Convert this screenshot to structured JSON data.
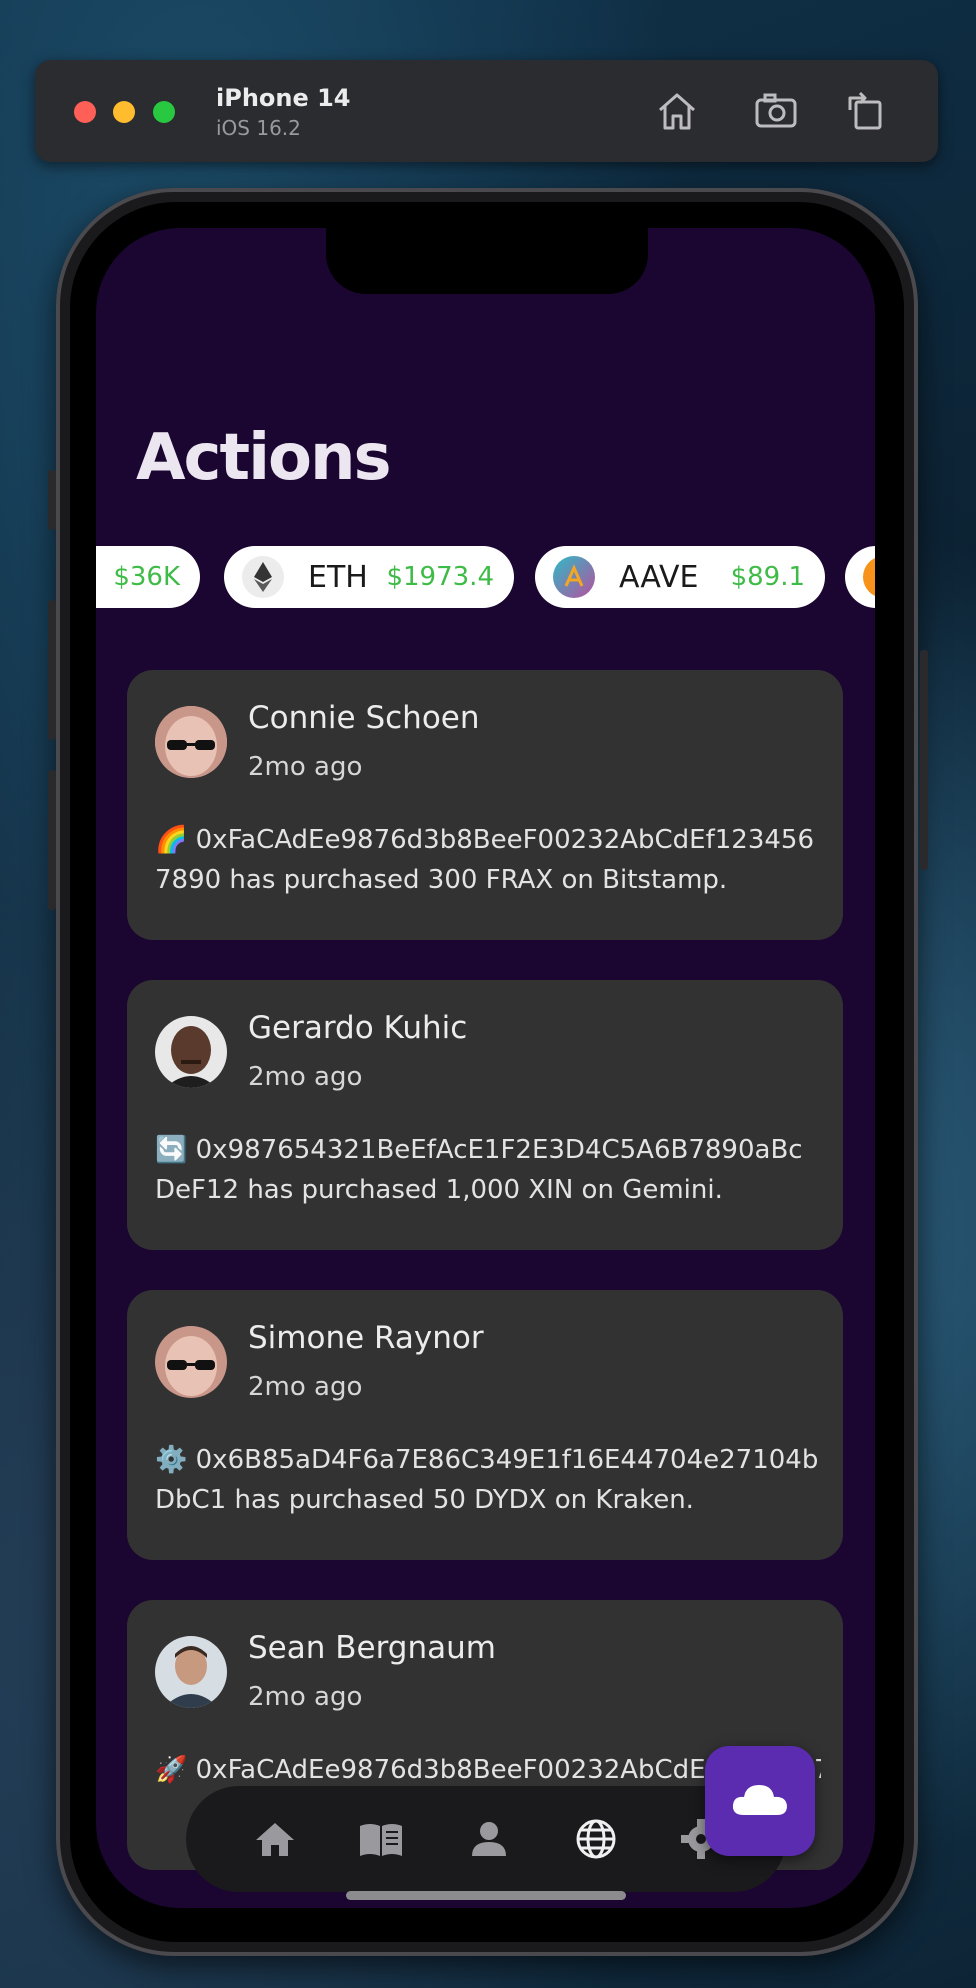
{
  "simulator": {
    "device_name": "iPhone 14",
    "os_version": "iOS 16.2",
    "buttons": [
      "home-icon",
      "screenshot-icon",
      "rotate-icon"
    ]
  },
  "app": {
    "title": "Actions",
    "ticker": [
      {
        "symbol": "",
        "price": "$36K",
        "icon": "bitcoin-icon"
      },
      {
        "symbol": "ETH",
        "price": "$1973.4",
        "icon": "ethereum-icon"
      },
      {
        "symbol": "AAVE",
        "price": "$89.1",
        "icon": "aave-icon"
      },
      {
        "symbol": "",
        "price": "",
        "icon": "coin-icon"
      }
    ],
    "feed": [
      {
        "name": "Connie Schoen",
        "time": "2mo ago",
        "message": "🌈 0xFaCAdEe9876d3b8BeeF00232AbCdEf1234567890 has purchased 300 FRAX on Bitstamp."
      },
      {
        "name": "Gerardo Kuhic",
        "time": "2mo ago",
        "message": "🔄 0x987654321BeEfAcE1F2E3D4C5A6B7890aBcDeF12 has purchased 1,000 XIN on Gemini."
      },
      {
        "name": "Simone Raynor",
        "time": "2mo ago",
        "message": "⚙️ 0x6B85aD4F6a7E86C349E1f16E44704e27104bDbC1 has purchased 50 DYDX on Kraken."
      },
      {
        "name": "Sean Bergnaum",
        "time": "2mo ago",
        "message": "🚀 0xFaCAdEe9876d3b8BeeF00232AbCdEf1234567890"
      }
    ],
    "nav": [
      "home-icon",
      "book-icon",
      "person-icon",
      "globe-icon",
      "settings-icon"
    ],
    "fab_icon": "cloud-icon",
    "colors": {
      "background": "#1a0630",
      "card": "#333233",
      "price_green": "#3fbb47",
      "fab": "#5b2bb0"
    }
  }
}
